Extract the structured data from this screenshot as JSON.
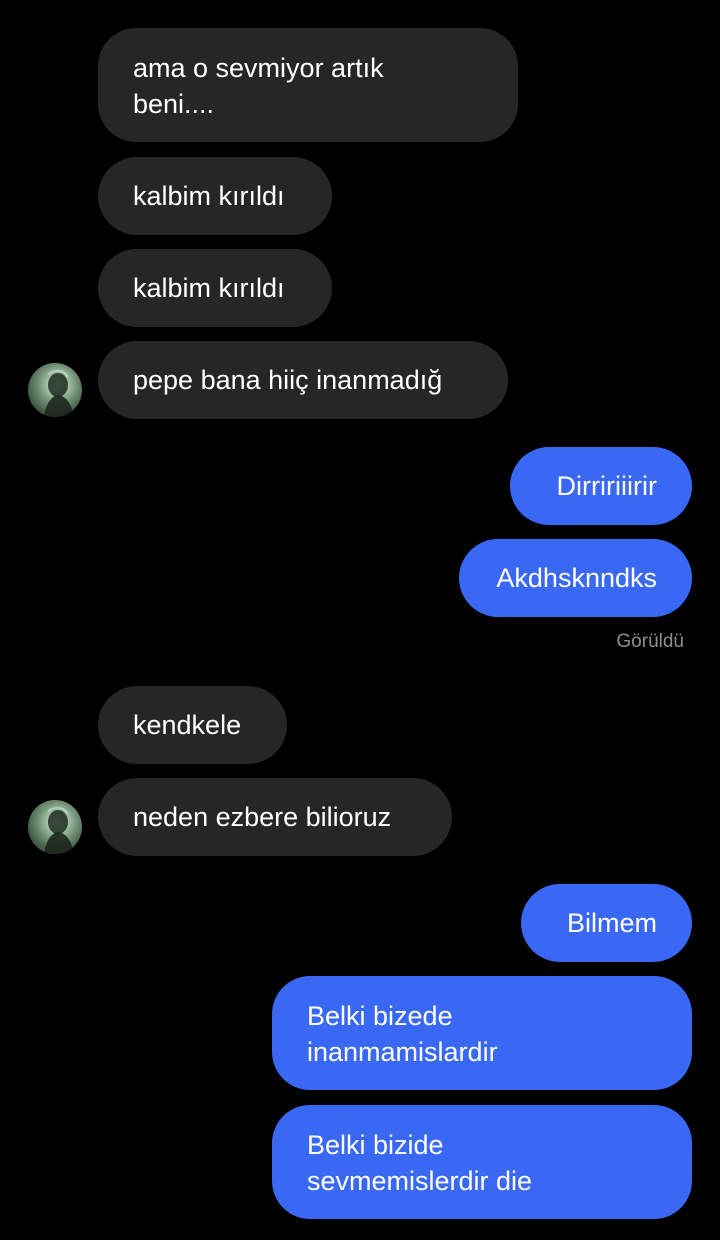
{
  "messages": [
    {
      "id": "m1",
      "direction": "incoming",
      "text": "ama o sevmiyor artık beni...."
    },
    {
      "id": "m2",
      "direction": "incoming",
      "text": "kalbim kırıldı"
    },
    {
      "id": "m3",
      "direction": "incoming",
      "text": "kalbim kırıldı"
    },
    {
      "id": "m4",
      "direction": "incoming",
      "text": "pepe bana hiiç inanmadığ",
      "avatar": true
    },
    {
      "id": "m5",
      "direction": "outgoing",
      "text": "Dirririiirir"
    },
    {
      "id": "m6",
      "direction": "outgoing",
      "text": "Akdhsknndks"
    },
    {
      "id": "m7",
      "direction": "incoming",
      "text": "kendkele"
    },
    {
      "id": "m8",
      "direction": "incoming",
      "text": "neden ezbere bilioruz",
      "avatar": true
    },
    {
      "id": "m9",
      "direction": "outgoing",
      "text": "Bilmem"
    },
    {
      "id": "m10",
      "direction": "outgoing",
      "text": "Belki bizede inanmamislardir"
    },
    {
      "id": "m11",
      "direction": "outgoing",
      "text": "Belki bizide sevmemislerdir die"
    }
  ],
  "status": {
    "seen_label": "Görüldü"
  },
  "colors": {
    "background": "#000000",
    "incoming_bubble": "#262626",
    "outgoing_bubble": "#3968f5",
    "text": "#ffffff",
    "status_text": "#8e8e8e"
  },
  "icons": {
    "contact_avatar": "profile-photo-avatar"
  }
}
